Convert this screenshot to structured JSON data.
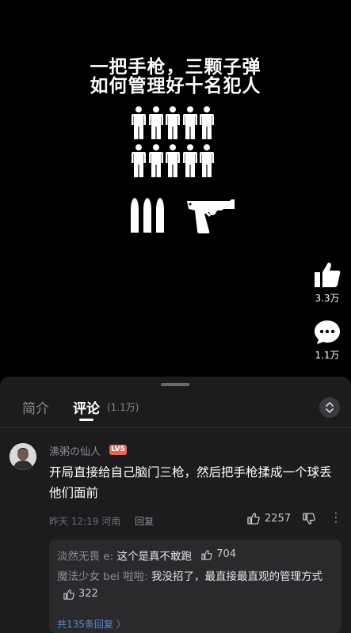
{
  "video": {
    "title_line1": "一把手枪，三颗子弹",
    "title_line2": "如何管理好十名犯人",
    "prisoner_count": 10,
    "bullet_count": 3
  },
  "actions": {
    "like_count": "3.3万",
    "comment_count": "1.1万"
  },
  "sheet": {
    "tabs": [
      {
        "label": "简介",
        "active": false
      },
      {
        "label": "评论",
        "active": true
      }
    ],
    "comment_tab_count": "(1.1万)"
  },
  "comment": {
    "username": "沸粥の仙人",
    "level_badge": "LV5",
    "text": "开局直接给自己脑门三枪，然后把手枪揉成一个球丢他们面前",
    "time": "昨天 12:19",
    "location": "河南",
    "reply_label": "回复",
    "likes": "2257"
  },
  "replies": [
    {
      "name": "淡然无畏 e:",
      "text": " 这个是真不敢跑",
      "likes": "704"
    },
    {
      "name": "魔法少女 bei 啦啦:",
      "text": " 我没招了，最直接最直观的管理方式",
      "likes": "322"
    }
  ],
  "more_replies": "共135条回复 〉",
  "colors": {
    "background": "#000000",
    "sheet": "#1c1c1e",
    "reply_box": "#2a2a2c",
    "badge": "#e06a5a",
    "link": "#5b8bd6"
  },
  "icons": [
    "thumbs-up-icon",
    "chat-bubble-icon",
    "chevron-updown-icon",
    "dislike-icon",
    "more-icon",
    "person-icon",
    "bullet-icon",
    "pistol-icon"
  ]
}
